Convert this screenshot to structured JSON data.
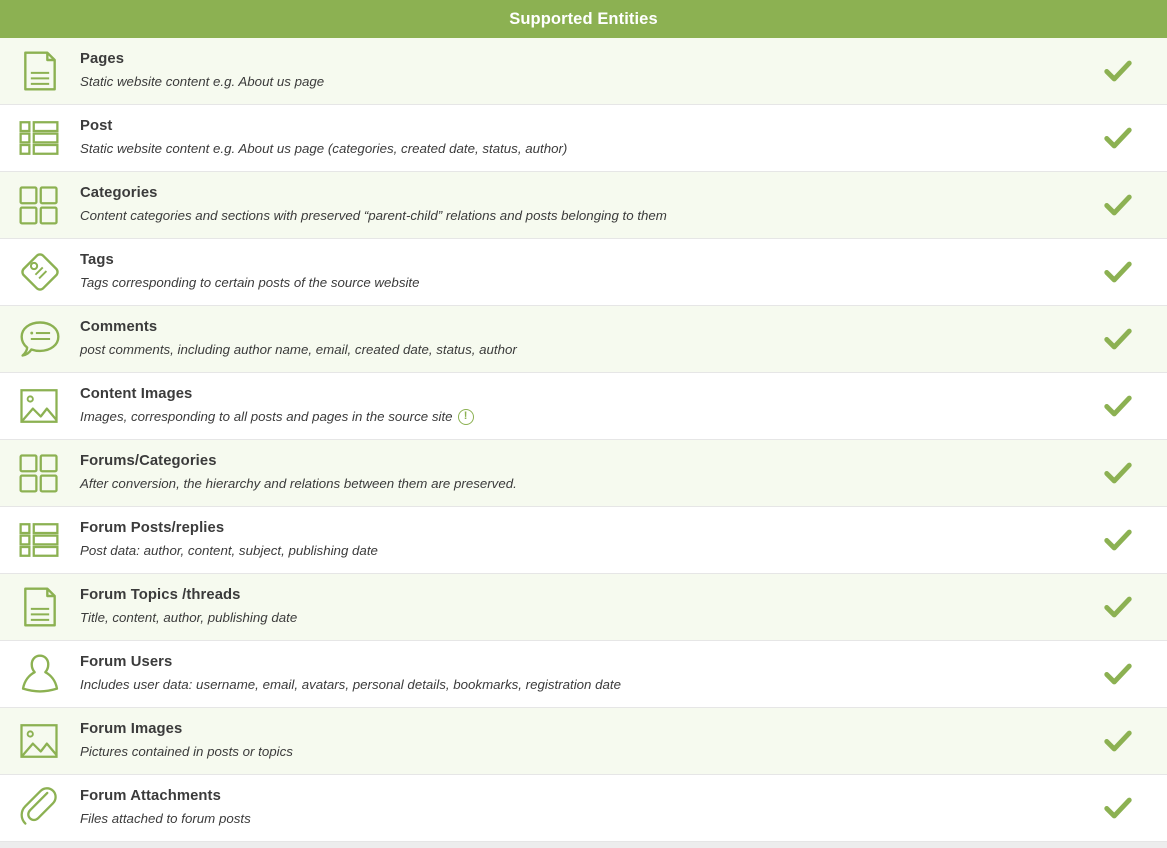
{
  "header": {
    "title": "Supported Entities",
    "background_color": "#8cb152",
    "text_color": "#ffffff"
  },
  "colors": {
    "accent_green": "#8cb152",
    "icon_green": "#8cb152",
    "check_green": "#8cb152",
    "row_alt_background": "#f6faef",
    "row_background": "#ffffff",
    "title_text": "#3b3b3b",
    "row_divider": "#e6e6e6"
  },
  "rows": [
    {
      "title": "Pages",
      "description": "Static website content e.g. About us page",
      "icon": "document-page-icon",
      "supported": true,
      "check_glyph": "✔",
      "info_badge": null
    },
    {
      "title": "Post",
      "description": "Static website content e.g. About us page (categories, created date, status, author)",
      "icon": "list-rows-icon",
      "supported": true,
      "check_glyph": "✔",
      "info_badge": null
    },
    {
      "title": "Categories",
      "description": "Content categories and sections with preserved “parent-child” relations and posts belonging to them",
      "icon": "grid-four-squares-icon",
      "supported": true,
      "check_glyph": "✔",
      "info_badge": null
    },
    {
      "title": "Tags",
      "description": "Tags corresponding to certain posts of the source website",
      "icon": "tag-icon",
      "supported": true,
      "check_glyph": "✔",
      "info_badge": null
    },
    {
      "title": "Comments",
      "description": "post comments, including author name, email, created date, status, author",
      "icon": "speech-bubble-icon",
      "supported": true,
      "check_glyph": "✔",
      "info_badge": null
    },
    {
      "title": "Content Images",
      "description": "Images, corresponding to all posts and pages in the source site",
      "icon": "picture-icon",
      "supported": true,
      "check_glyph": "✔",
      "info_badge": "!"
    },
    {
      "title": "Forums/Categories",
      "description": "After conversion, the hierarchy and relations between them are preserved.",
      "icon": "grid-four-squares-icon",
      "supported": true,
      "check_glyph": "✔",
      "info_badge": null
    },
    {
      "title": "Forum Posts/replies",
      "description": "Post data: author, content, subject, publishing date",
      "icon": "list-rows-icon",
      "supported": true,
      "check_glyph": "✔",
      "info_badge": null
    },
    {
      "title": "Forum Topics /threads",
      "description": "Title, content, author, publishing date",
      "icon": "document-page-icon",
      "supported": true,
      "check_glyph": "✔",
      "info_badge": null
    },
    {
      "title": "Forum Users",
      "description": "Includes user data: username, email, avatars, personal details, bookmarks, registration date",
      "icon": "user-icon",
      "supported": true,
      "check_glyph": "✔",
      "info_badge": null
    },
    {
      "title": "Forum Images",
      "description": "Pictures contained in posts or topics",
      "icon": "picture-icon",
      "supported": true,
      "check_glyph": "✔",
      "info_badge": null
    },
    {
      "title": "Forum Attachments",
      "description": "Files attached to forum posts",
      "icon": "paperclip-icon",
      "supported": true,
      "check_glyph": "✔",
      "info_badge": null
    }
  ]
}
